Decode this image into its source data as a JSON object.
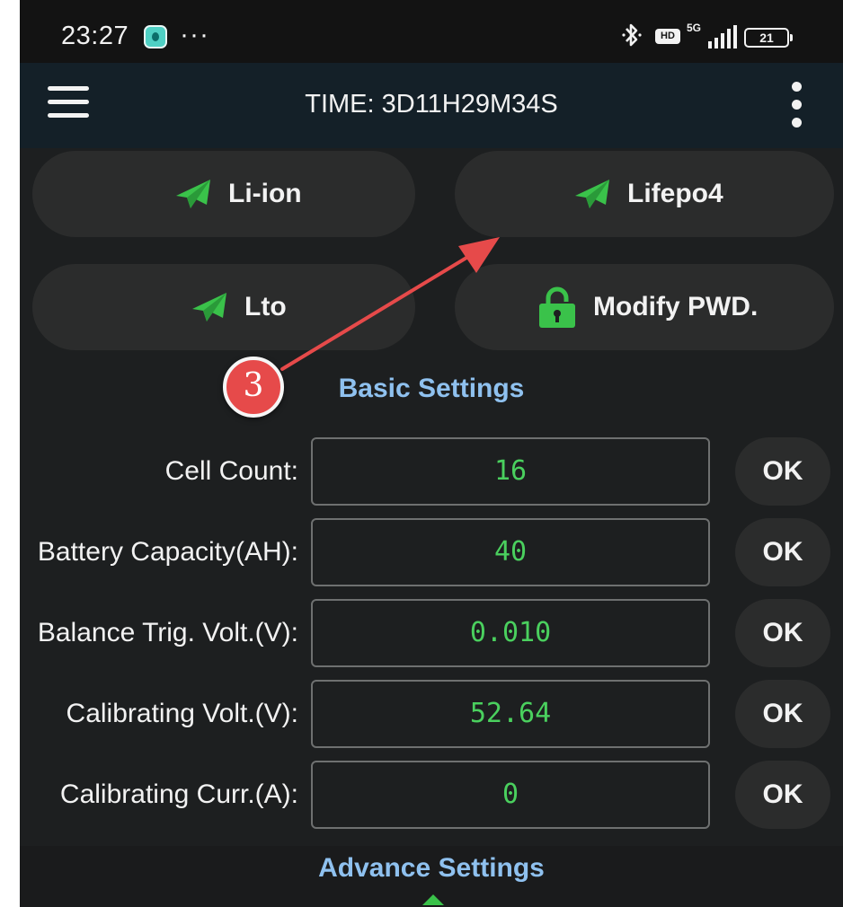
{
  "status_bar": {
    "time": "23:27",
    "overflow": "···",
    "hd": "HD",
    "network": "5G",
    "battery": "21",
    "icons": [
      "app-notification-icon",
      "bluetooth-icon",
      "hd-icon",
      "signal-icon",
      "battery-icon"
    ]
  },
  "app_bar": {
    "title": "TIME: 3D11H29M34S",
    "menu_icon": "hamburger-menu-icon",
    "more_icon": "more-vertical-icon"
  },
  "presets": {
    "li_ion": "Li-ion",
    "lifepo4": "Lifepo4",
    "lto": "Lto",
    "modify_pwd": "Modify PWD.",
    "preset_icon": "paper-plane-icon",
    "pwd_icon": "padlock-icon",
    "accent": "#3ac24a"
  },
  "basic_settings": {
    "title": "Basic Settings",
    "rows": [
      {
        "label": "Cell Count:",
        "value": "16",
        "button": "OK"
      },
      {
        "label": "Battery Capacity(AH):",
        "value": "40",
        "button": "OK"
      },
      {
        "label": "Balance Trig. Volt.(V):",
        "value": "0.010",
        "button": "OK"
      },
      {
        "label": "Calibrating Volt.(V):",
        "value": "52.64",
        "button": "OK"
      },
      {
        "label": "Calibrating Curr.(A):",
        "value": "0",
        "button": "OK"
      }
    ]
  },
  "advance_settings": {
    "title": "Advance Settings"
  },
  "annotation": {
    "step": "3",
    "color": "#e64a4a"
  },
  "colors": {
    "background": "#1d1f20",
    "value_text": "#4ad05e",
    "section_title": "#8fc1ef"
  }
}
